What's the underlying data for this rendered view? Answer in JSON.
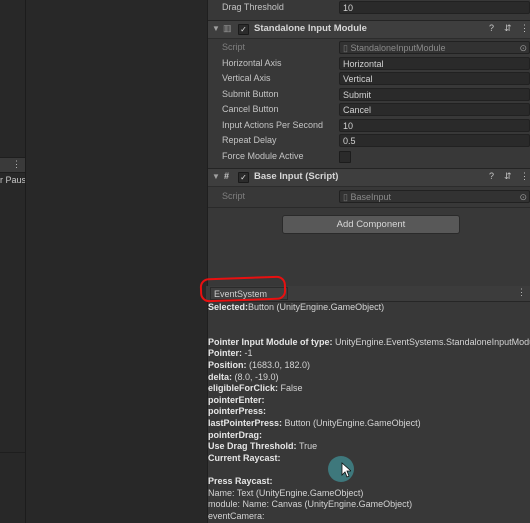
{
  "left_panel": {
    "tab_menu": "⋮",
    "clipped_text": "r Paus"
  },
  "inspector": {
    "drag_threshold": {
      "label": "Drag Threshold",
      "value": "10"
    },
    "standalone": {
      "title": "Standalone Input Module",
      "checkbox": "✓",
      "rows": [
        {
          "label": "Script",
          "value": "StandaloneInputModule"
        },
        {
          "label": "Horizontal Axis",
          "value": "Horizontal"
        },
        {
          "label": "Vertical Axis",
          "value": "Vertical"
        },
        {
          "label": "Submit Button",
          "value": "Submit"
        },
        {
          "label": "Cancel Button",
          "value": "Cancel"
        },
        {
          "label": "Input Actions Per Second",
          "value": "10"
        },
        {
          "label": "Repeat Delay",
          "value": "0.5"
        },
        {
          "label": "Force Module Active",
          "value": ""
        }
      ]
    },
    "base_input": {
      "title": "Base Input (Script)",
      "checkbox": "✓",
      "rows": [
        {
          "label": "Script",
          "value": "BaseInput"
        }
      ]
    },
    "add_component": "Add Component",
    "icons": {
      "help": "?",
      "preset": "⇵",
      "menu": "⋮",
      "target": "⊙",
      "script": "#"
    }
  },
  "debug": {
    "tab": "EventSystem",
    "lines": [
      {
        "key": "Selected:",
        "val": "Button (UnityEngine.GameObject)"
      },
      {
        "key": "",
        "val": ""
      },
      {
        "key": "",
        "val": ""
      },
      {
        "key": "Pointer Input Module of type: ",
        "val": "UnityEngine.EventSystems.StandaloneInputModule"
      },
      {
        "key": "Pointer: ",
        "val": "-1"
      },
      {
        "key": "Position: ",
        "val": "(1683.0, 182.0)"
      },
      {
        "key": "delta: ",
        "val": "(8.0, -19.0)"
      },
      {
        "key": "eligibleForClick: ",
        "val": "False"
      },
      {
        "key": "pointerEnter:",
        "val": ""
      },
      {
        "key": "pointerPress:",
        "val": ""
      },
      {
        "key": "lastPointerPress: ",
        "val": "Button (UnityEngine.GameObject)"
      },
      {
        "key": "pointerDrag:",
        "val": ""
      },
      {
        "key": "Use Drag Threshold: ",
        "val": "True"
      },
      {
        "key": "Current Raycast:",
        "val": ""
      },
      {
        "key": "",
        "val": ""
      },
      {
        "key": "Press Raycast:",
        "val": ""
      },
      {
        "key": "",
        "val": "Name: Text (UnityEngine.GameObject)"
      },
      {
        "key": "",
        "val": "module: Name: Canvas (UnityEngine.GameObject)"
      },
      {
        "key": "",
        "val": "eventCamera:"
      }
    ]
  }
}
